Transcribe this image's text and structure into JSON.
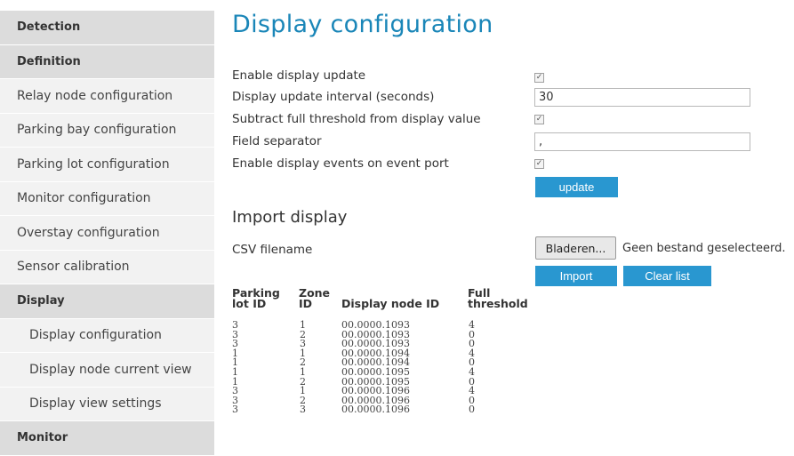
{
  "sidebar": {
    "items": [
      {
        "label": "Detection",
        "type": "header"
      },
      {
        "label": "Definition",
        "type": "header"
      },
      {
        "label": "Relay node configuration",
        "type": "item"
      },
      {
        "label": "Parking bay configuration",
        "type": "item"
      },
      {
        "label": "Parking lot configuration",
        "type": "item"
      },
      {
        "label": "Monitor configuration",
        "type": "item"
      },
      {
        "label": "Overstay configuration",
        "type": "item"
      },
      {
        "label": "Sensor calibration",
        "type": "item"
      },
      {
        "label": "Display",
        "type": "header"
      },
      {
        "label": "Display configuration",
        "type": "sub"
      },
      {
        "label": "Display node current view",
        "type": "sub"
      },
      {
        "label": "Display view settings",
        "type": "sub"
      },
      {
        "label": "Monitor",
        "type": "header"
      }
    ]
  },
  "main": {
    "title": "Display configuration",
    "settings": {
      "enable_display_update": {
        "label": "Enable display update",
        "checked": true
      },
      "update_interval": {
        "label": "Display update interval (seconds)",
        "value": "30"
      },
      "subtract_threshold": {
        "label": "Subtract full threshold from display value",
        "checked": true
      },
      "field_separator": {
        "label": "Field separator",
        "value": ","
      },
      "enable_events": {
        "label": "Enable display events on event port",
        "checked": true
      }
    },
    "update_button": "update",
    "import": {
      "title": "Import display",
      "csv_label": "CSV filename",
      "browse_button": "Bladeren...",
      "file_status": "Geen bestand geselecteerd.",
      "import_button": "Import",
      "clear_button": "Clear list"
    },
    "table": {
      "headers": {
        "lot": "Parking lot ID",
        "zone": "Zone ID",
        "node": "Display node ID",
        "threshold": "Full threshold"
      },
      "rows": [
        {
          "lot": "3",
          "zone": "1",
          "node": "00.0000.1093",
          "threshold": "4"
        },
        {
          "lot": "3",
          "zone": "2",
          "node": "00.0000.1093",
          "threshold": "0"
        },
        {
          "lot": "3",
          "zone": "3",
          "node": "00.0000.1093",
          "threshold": "0"
        },
        {
          "lot": "1",
          "zone": "1",
          "node": "00.0000.1094",
          "threshold": "4"
        },
        {
          "lot": "1",
          "zone": "2",
          "node": "00.0000.1094",
          "threshold": "0"
        },
        {
          "lot": "1",
          "zone": "1",
          "node": "00.0000.1095",
          "threshold": "4"
        },
        {
          "lot": "1",
          "zone": "2",
          "node": "00.0000.1095",
          "threshold": "0"
        },
        {
          "lot": "3",
          "zone": "1",
          "node": "00.0000.1096",
          "threshold": "4"
        },
        {
          "lot": "3",
          "zone": "2",
          "node": "00.0000.1096",
          "threshold": "0"
        },
        {
          "lot": "3",
          "zone": "3",
          "node": "00.0000.1096",
          "threshold": "0"
        }
      ]
    }
  }
}
